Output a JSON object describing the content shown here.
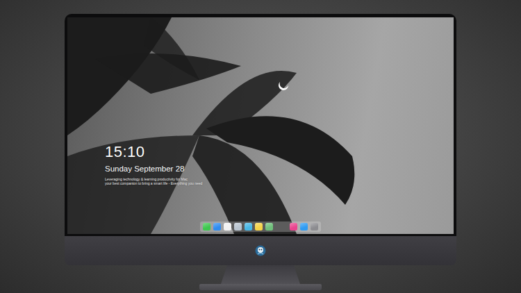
{
  "clock": {
    "time": "15:10",
    "date": "Sunday September 28",
    "lines": [
      "Leveraging technology & learning productivity for Mac",
      "your best companion to bring a smart life - Everything you need"
    ]
  },
  "dock": {
    "apps": [
      {
        "color": "#3ec74f"
      },
      {
        "color": "#2f8cf0"
      },
      {
        "color": "#f2f2f2"
      },
      {
        "color": "#b9c4cf"
      },
      {
        "color": "#48b7e6"
      },
      {
        "color": "#f5d347"
      },
      {
        "color": "#6fbf7a"
      }
    ],
    "extras": [
      {
        "color": "#e9438e"
      },
      {
        "color": "#2f9bf2"
      },
      {
        "color": "#8c8c90"
      }
    ]
  }
}
